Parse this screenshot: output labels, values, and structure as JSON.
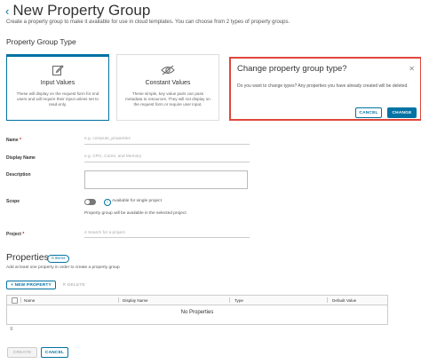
{
  "page": {
    "back_icon": "chevron-left-icon",
    "title": "New Property Group",
    "subtitle": "Create a property group to make it available for use in cloud templates. You can choose from 2 types of property groups."
  },
  "type_section": {
    "heading": "Property Group Type",
    "cards": [
      {
        "icon": "edit-icon",
        "title": "Input Values",
        "description": "These will display on the request form for end users and will require their input unless set to read-only.",
        "selected": true
      },
      {
        "icon": "eye-hide-icon",
        "title": "Constant Values",
        "description": "These simple, key value pairs can pass metadata to resources. They will not display on the request form or require user input.",
        "selected": false
      }
    ]
  },
  "dialog": {
    "title": "Change property group type?",
    "close_icon": "close-icon",
    "message": "Do you want to change types? Any properties you have already created will be deleted.",
    "cancel_label": "CANCEL",
    "confirm_label": "CHANGE"
  },
  "form": {
    "name_label": "Name",
    "name_placeholder": "e.g. compute_properties",
    "display_name_label": "Display Name",
    "display_name_placeholder": "e.g. CPU, Cores, and Memory",
    "description_label": "Description",
    "scope_label": "Scope",
    "scope_toggle_text": "Available for single project",
    "scope_info_icon": "info-icon",
    "scope_help": "Property group will be available in the selected project",
    "project_label": "Project",
    "project_placeholder": "Search for a project",
    "required_mark": "*"
  },
  "properties": {
    "heading": "Properties",
    "count_badge": "0 items",
    "hint": "Add at least one property in order to create a property group",
    "new_label": "+ NEW PROPERTY",
    "delete_label": "✕ DELETE",
    "columns": [
      "Name",
      "Display Name",
      "Type",
      "Default Value"
    ],
    "empty_text": "No Properties",
    "column_toggle_icon": "columns-icon"
  },
  "footer": {
    "create_label": "CREATE",
    "cancel_label": "CANCEL"
  },
  "colors": {
    "accent": "#0072a3",
    "danger_outline": "#e0463c",
    "required": "#c21d00"
  }
}
